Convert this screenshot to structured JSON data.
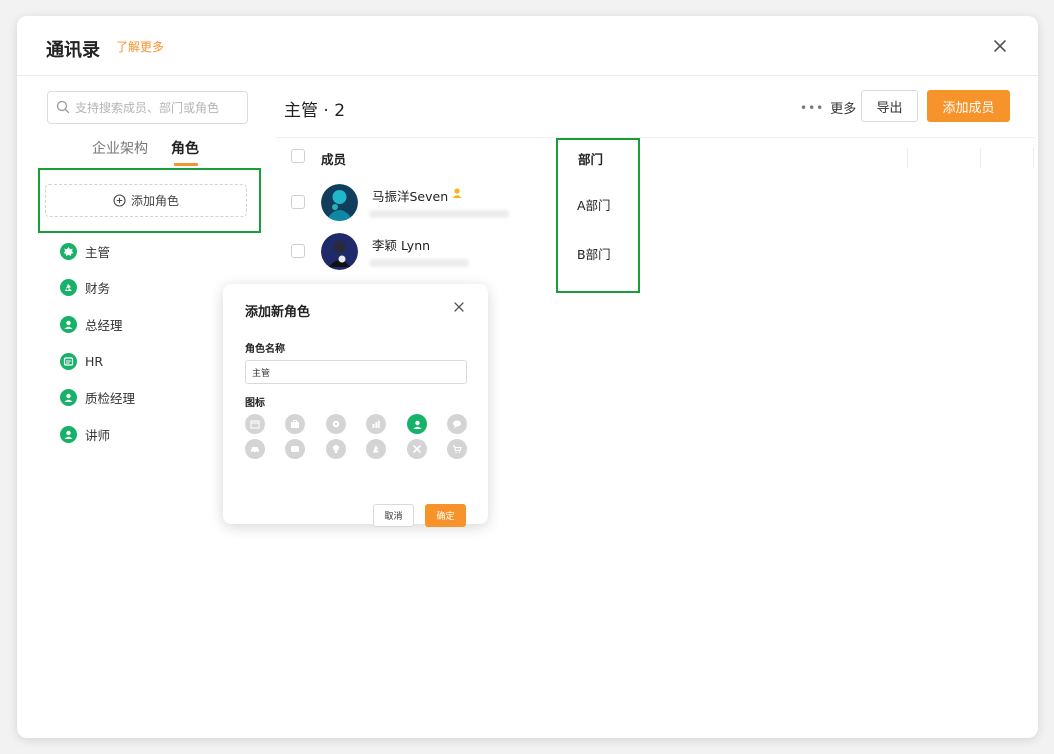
{
  "window": {
    "title": "通讯录",
    "learn_more": "了解更多"
  },
  "sidebar": {
    "search_placeholder": "支持搜索成员、部门或角色",
    "tabs": [
      {
        "label": "企业架构",
        "active": false
      },
      {
        "label": "角色",
        "active": true
      }
    ],
    "add_role_label": "添加角色",
    "roles": [
      {
        "label": "主管",
        "icon": "crown-badge-icon"
      },
      {
        "label": "财务",
        "icon": "finance-icon"
      },
      {
        "label": "总经理",
        "icon": "user-icon"
      },
      {
        "label": "HR",
        "icon": "hr-card-icon"
      },
      {
        "label": "质检经理",
        "icon": "user-icon"
      },
      {
        "label": "讲师",
        "icon": "user-icon"
      }
    ]
  },
  "main": {
    "section_title": "主管 · 2",
    "more_label": "更多",
    "export_label": "导出",
    "add_member_label": "添加成员",
    "table": {
      "columns": [
        "成员",
        "部门"
      ],
      "rows": [
        {
          "name": "马振洋Seven",
          "dept": "A部门",
          "has_admin_badge": true
        },
        {
          "name": "李颖 Lynn",
          "dept": "B部门",
          "has_admin_badge": false
        }
      ]
    }
  },
  "dialog": {
    "title": "添加新角色",
    "name_label": "角色名称",
    "name_value": "主管",
    "icon_label": "图标",
    "icons": [
      {
        "name": "calendar-icon",
        "selected": false
      },
      {
        "name": "briefcase-icon",
        "selected": false
      },
      {
        "name": "gear-icon",
        "selected": false
      },
      {
        "name": "chart-icon",
        "selected": false
      },
      {
        "name": "user-icon",
        "selected": true
      },
      {
        "name": "chat-icon",
        "selected": false
      },
      {
        "name": "car-icon",
        "selected": false
      },
      {
        "name": "message-icon",
        "selected": false
      },
      {
        "name": "bulb-icon",
        "selected": false
      },
      {
        "name": "finance-icon",
        "selected": false
      },
      {
        "name": "tools-icon",
        "selected": false
      },
      {
        "name": "cart-icon",
        "selected": false
      }
    ],
    "cancel_label": "取消",
    "confirm_label": "确定"
  },
  "colors": {
    "accent_orange": "#f7932b",
    "role_green": "#17b26a",
    "highlight_green": "#1a9c38",
    "admin_badge": "#f5b418"
  }
}
